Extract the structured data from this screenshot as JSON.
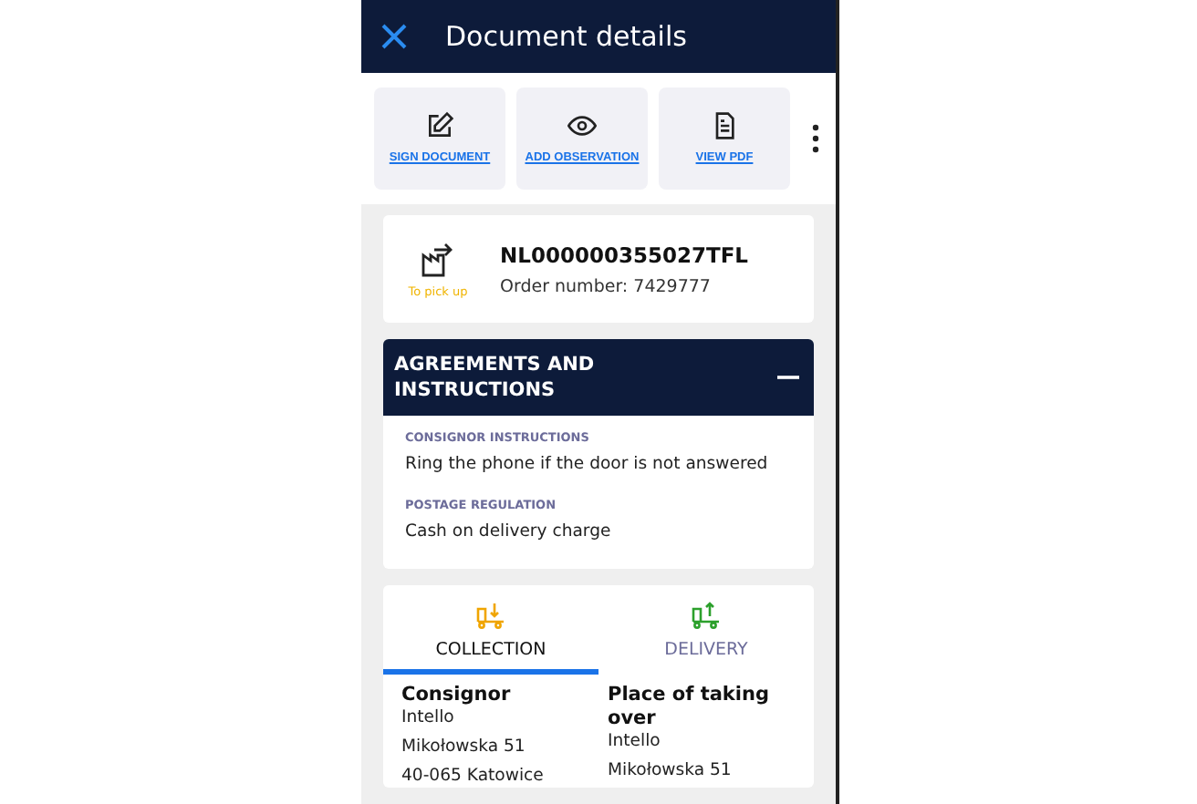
{
  "header": {
    "title": "Document details"
  },
  "actions": [
    {
      "kind": "sign",
      "label": "SIGN DOCUMENT"
    },
    {
      "kind": "observe",
      "label": "ADD OBSERVATION"
    },
    {
      "kind": "pdf",
      "label": "VIEW PDF"
    }
  ],
  "document": {
    "status": "To pick up",
    "number": "NL000000355027TFL",
    "order": "Order number: 7429777"
  },
  "agreements": {
    "title": "AGREEMENTS AND INSTRUCTIONS",
    "expanded": true,
    "sections": [
      {
        "label": "CONSIGNOR INSTRUCTIONS",
        "value": "Ring the phone if the door is not answered"
      },
      {
        "label": "POSTAGE REGULATION",
        "value": "Cash on delivery charge"
      }
    ]
  },
  "tabs": [
    {
      "kind": "collection",
      "label": "COLLECTION",
      "selected": true
    },
    {
      "kind": "delivery",
      "label": "DELIVERY",
      "selected": false
    }
  ],
  "columns": [
    {
      "title": "Consignor",
      "lines": [
        "Intello",
        "Mikołowska 51",
        "40-065 Katowice"
      ]
    },
    {
      "title": "Place of taking over",
      "lines": [
        "Intello",
        "Mikołowska 51"
      ]
    }
  ]
}
